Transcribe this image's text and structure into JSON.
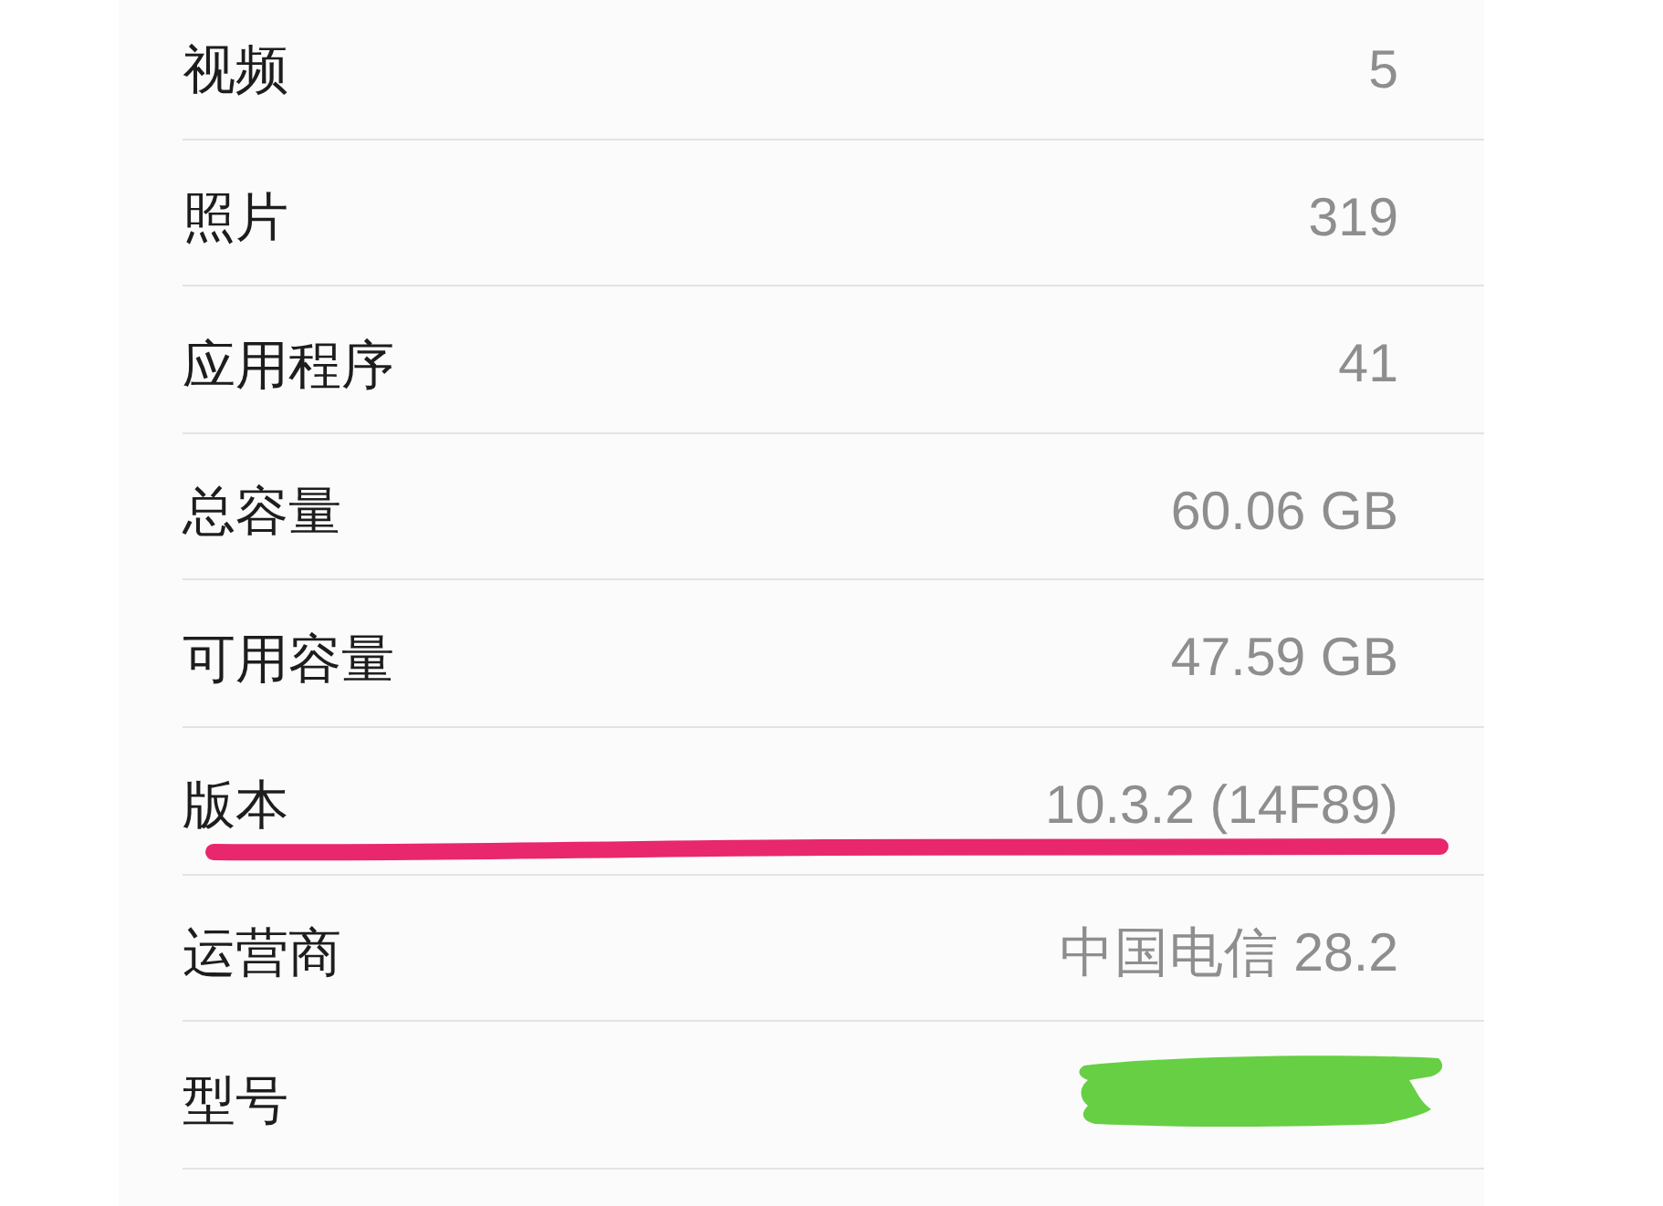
{
  "rows": [
    {
      "label": "视频",
      "value": "5",
      "underlined": false,
      "scribbled_out": false
    },
    {
      "label": "照片",
      "value": "319",
      "underlined": false,
      "scribbled_out": false
    },
    {
      "label": "应用程序",
      "value": "41",
      "underlined": false,
      "scribbled_out": false
    },
    {
      "label": "总容量",
      "value": "60.06 GB",
      "underlined": false,
      "scribbled_out": false
    },
    {
      "label": "可用容量",
      "value": "47.59 GB",
      "underlined": false,
      "scribbled_out": false
    },
    {
      "label": "版本",
      "value": "10.3.2 (14F89)",
      "underlined": true,
      "scribbled_out": false
    },
    {
      "label": "运营商",
      "value": "中国电信 28.2",
      "underlined": false,
      "scribbled_out": false
    },
    {
      "label": "型号",
      "underlined": false,
      "scribbled_out": true
    }
  ]
}
